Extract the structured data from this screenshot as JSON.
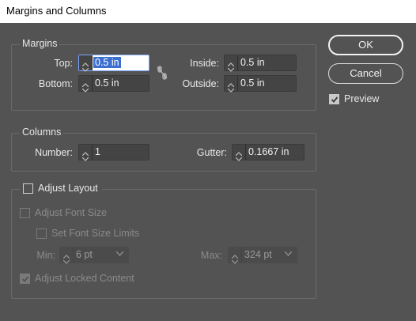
{
  "window": {
    "title": "Margins and Columns"
  },
  "margins": {
    "title": "Margins",
    "top": {
      "label": "Top:",
      "value": "0.5 in"
    },
    "bottom": {
      "label": "Bottom:",
      "value": "0.5 in"
    },
    "inside": {
      "label": "Inside:",
      "value": "0.5 in"
    },
    "outside": {
      "label": "Outside:",
      "value": "0.5 in"
    }
  },
  "columns": {
    "title": "Columns",
    "number": {
      "label": "Number:",
      "value": "1"
    },
    "gutter": {
      "label": "Gutter:",
      "value": "0.1667 in"
    }
  },
  "adjust_layout": {
    "label": "Adjust Layout",
    "checked": false,
    "adjust_font_size": {
      "label": "Adjust Font Size",
      "checked": false
    },
    "set_font_size_limits": {
      "label": "Set Font Size Limits",
      "checked": false
    },
    "min": {
      "label": "Min:",
      "value": "6 pt"
    },
    "max": {
      "label": "Max:",
      "value": "324 pt"
    },
    "adjust_locked_content": {
      "label": "Adjust Locked Content",
      "checked": true
    }
  },
  "buttons": {
    "ok": "OK",
    "cancel": "Cancel"
  },
  "preview": {
    "label": "Preview",
    "checked": true
  },
  "colors": {
    "background": "#535353",
    "focus_highlight": "#3d6fd1",
    "titlebar": "#ffffff"
  }
}
